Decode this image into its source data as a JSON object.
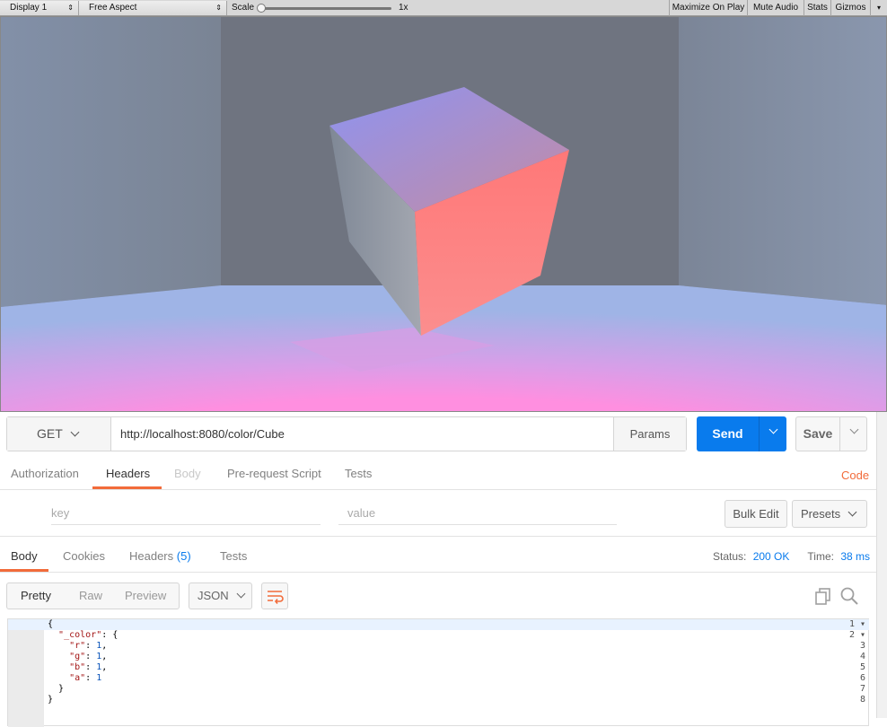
{
  "unity_toolbar": {
    "display": "Display 1",
    "aspect": "Free Aspect",
    "scale_label": "Scale",
    "scale_value": "1x",
    "maximize": "Maximize On Play",
    "mute": "Mute Audio",
    "stats": "Stats",
    "gizmos": "Gizmos"
  },
  "request": {
    "method": "GET",
    "url": "http://localhost:8080/color/Cube",
    "params": "Params",
    "send": "Send",
    "save": "Save"
  },
  "req_tabs": [
    "Authorization",
    "Headers",
    "Body",
    "Pre-request Script",
    "Tests"
  ],
  "code_link": "Code",
  "headers_editor": {
    "key_placeholder": "key",
    "value_placeholder": "value",
    "bulk_edit": "Bulk Edit",
    "presets": "Presets"
  },
  "resp_tabs": {
    "body": "Body",
    "cookies": "Cookies",
    "headers": "Headers",
    "headers_count": "(5)",
    "tests": "Tests"
  },
  "status": {
    "label": "Status:",
    "value": "200 OK",
    "time_label": "Time:",
    "time_value": "38 ms"
  },
  "view": {
    "pretty": "Pretty",
    "raw": "Raw",
    "preview": "Preview",
    "format": "JSON"
  },
  "code_lines": [
    {
      "n": "1",
      "text": "{"
    },
    {
      "n": "2",
      "text": "  \"_color\": {"
    },
    {
      "n": "3",
      "text": "    \"r\": 1,"
    },
    {
      "n": "4",
      "text": "    \"g\": 1,"
    },
    {
      "n": "5",
      "text": "    \"b\": 1,"
    },
    {
      "n": "6",
      "text": "    \"a\": 1"
    },
    {
      "n": "7",
      "text": "  }"
    },
    {
      "n": "8",
      "text": "}"
    }
  ],
  "colors": {
    "accent_blue": "#097bed",
    "accent_orange": "#f26b3a",
    "cube_face": "#fd7d7d"
  }
}
